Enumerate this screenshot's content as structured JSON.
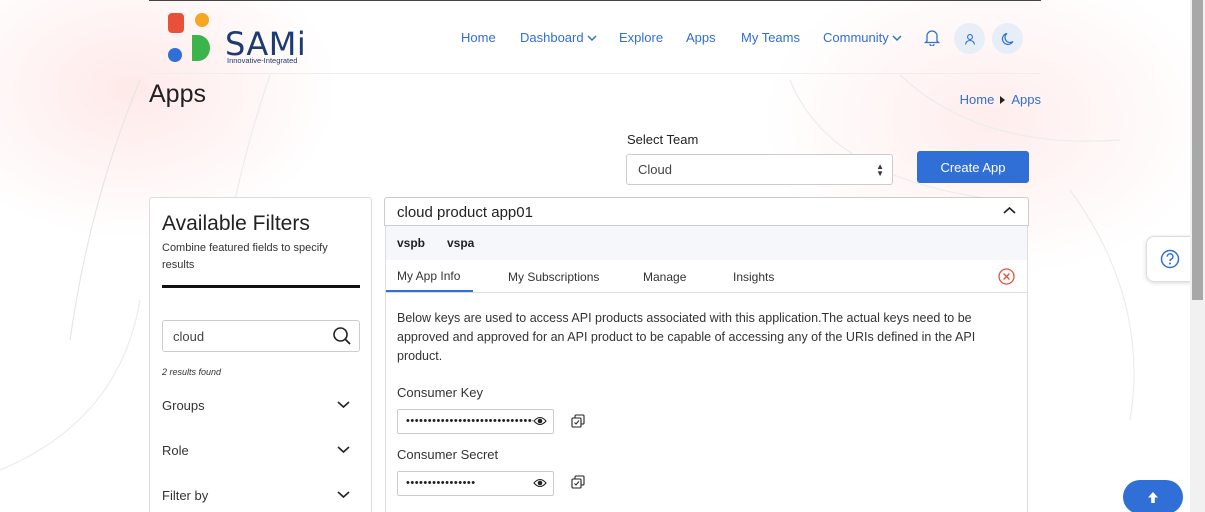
{
  "brand": {
    "name": "SAMi",
    "tagline": "Innovative-Integrated",
    "colors": {
      "red": "#e8503a",
      "orange": "#f5a623",
      "blue": "#2f6fd6",
      "green": "#3bb54a",
      "navy": "#1d3b73"
    }
  },
  "nav": {
    "home": "Home",
    "dashboard": "Dashboard",
    "explore": "Explore",
    "apps": "Apps",
    "my_teams": "My Teams",
    "community": "Community",
    "icons": [
      "bell-icon",
      "user-icon",
      "moon-icon"
    ]
  },
  "page": {
    "title": "Apps",
    "breadcrumb": [
      "Home",
      "Apps"
    ]
  },
  "team": {
    "label": "Select Team",
    "selected": "Cloud"
  },
  "create_app_label": "Create App",
  "filters": {
    "title": "Available Filters",
    "subtitle": "Combine featured fields to specify results",
    "search_value": "cloud",
    "results": "2 results found",
    "facets": [
      "Groups",
      "Role",
      "Filter by"
    ]
  },
  "app": {
    "name": "cloud product app01",
    "sub_tabs": [
      "vspb",
      "vspa"
    ],
    "tabs": [
      "My App Info",
      "My Subscriptions",
      "Manage",
      "Insights"
    ],
    "description": "Below keys are used to access API products associated with this application.The actual keys need to be approved and approved for an API product to be capable of accessing any of the URIs defined in the API product.",
    "consumer_key_label": "Consumer Key",
    "consumer_key_masked": "••••••••••••••••••••••••••••••",
    "consumer_secret_label": "Consumer Secret",
    "consumer_secret_masked": "••••••••••••••••"
  },
  "accent_color": "#2f6fd6"
}
